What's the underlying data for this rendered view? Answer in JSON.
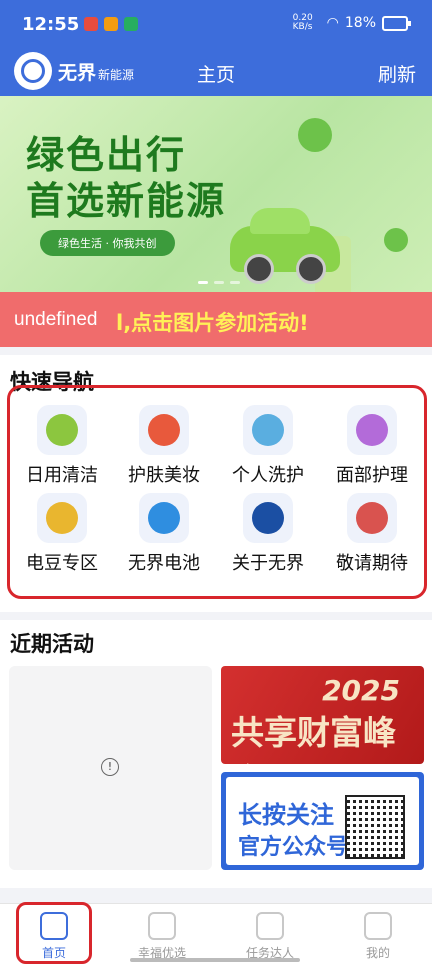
{
  "status_bar": {
    "time": "12:55",
    "speed": "0.20 KB/s",
    "battery": "18%",
    "battery_level": 0.18
  },
  "app_bar": {
    "brand": "无界",
    "brand_sub": "新能源",
    "title": "主页",
    "refresh": "刷新"
  },
  "banner": {
    "line1": "绿色出行",
    "line2": "首选新能源",
    "slogan": "绿色生活 · 你我共创"
  },
  "notice": {
    "prefix": "undefined",
    "text": "l,点击图片参加活动!"
  },
  "quick_nav": {
    "title": "快速导航",
    "items": [
      {
        "label": "日用清洁",
        "icon": "faucet-icon",
        "color": "#8cc63f"
      },
      {
        "label": "护肤美妆",
        "icon": "cosmetics-icon",
        "color": "#e8593c"
      },
      {
        "label": "个人洗护",
        "icon": "soap-icon",
        "color": "#5aaee0"
      },
      {
        "label": "面部护理",
        "icon": "skincare-bottle-icon",
        "color": "#b36bd9"
      },
      {
        "label": "电豆专区",
        "icon": "coins-icon",
        "color": "#e9b62f"
      },
      {
        "label": "无界电池",
        "icon": "battery-icon",
        "color": "#2f8ee0"
      },
      {
        "label": "关于无界",
        "icon": "logo-ring-icon",
        "color": "#1b4fa3"
      },
      {
        "label": "敬请期待",
        "icon": "hourglass-icon",
        "color": "#d9534f"
      }
    ]
  },
  "activities": {
    "title": "近期活动",
    "card_summit": {
      "year": "2025",
      "title": "共享财富峰会"
    },
    "card_follow": {
      "line1": "长按关注",
      "line2": "官方公众号"
    }
  },
  "tabbar": {
    "items": [
      {
        "label": "首页",
        "icon": "home-icon",
        "active": true
      },
      {
        "label": "幸福优选",
        "icon": "shopping-bag-icon",
        "active": false
      },
      {
        "label": "任务达人",
        "icon": "flame-icon",
        "active": false
      },
      {
        "label": "我的",
        "icon": "user-icon",
        "active": false
      }
    ]
  }
}
